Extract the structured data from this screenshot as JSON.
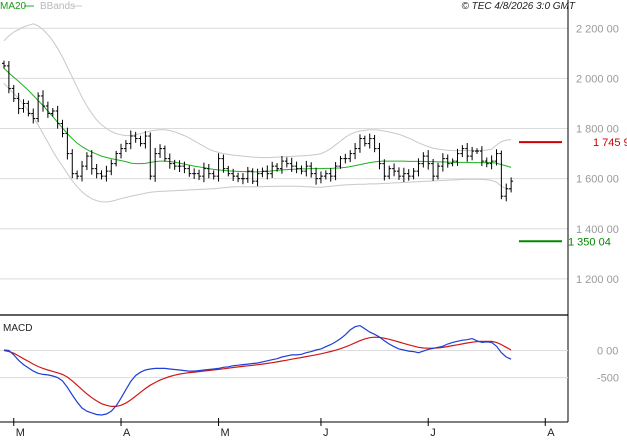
{
  "header": {
    "legend_ma": "MA20",
    "legend_bb": "BBands",
    "copyright": "© TEC 4/8/2026 3:0 GMT"
  },
  "colors": {
    "ma": "#1fb11f",
    "bbands": "#c8c8c8",
    "bars": "#000000",
    "macd_line": "#1f3fd6",
    "signal_line": "#d01818",
    "resistance": "#cc0000",
    "support": "#008800",
    "grid": "#dcdcdc"
  },
  "levels": {
    "resistance_label": "1 745 9",
    "support_label": "1 350 04"
  },
  "macd": {
    "title": "MACD"
  },
  "chart_data": [
    {
      "type": "ohlc",
      "title": "",
      "yticks": [
        "1 200 00",
        "1 400 00",
        "1 600 00",
        "1 800 00",
        "2 000 00",
        "2 200 00"
      ],
      "ytick_values": [
        1200,
        1400,
        1600,
        1800,
        2000,
        2200
      ],
      "ylim": [
        1060,
        2265
      ],
      "xlim": [
        0,
        115
      ],
      "x_ticks": [
        {
          "label": "M",
          "x": 2
        },
        {
          "label": "A",
          "x": 24
        },
        {
          "label": "M",
          "x": 44
        },
        {
          "label": "J",
          "x": 65
        },
        {
          "label": "J",
          "x": 87
        },
        {
          "label": "A",
          "x": 111
        }
      ],
      "x_tick_values": [
        2,
        24,
        44,
        65,
        87,
        111
      ],
      "grid": true,
      "legend": "top-left",
      "resistance": 1745.9,
      "support": 1350.04,
      "level_x_range": [
        112,
        121
      ],
      "closes": [
        2050,
        1960,
        1920,
        1880,
        1900,
        1860,
        1840,
        1930,
        1890,
        1860,
        1870,
        1820,
        1780,
        1700,
        1620,
        1610,
        1650,
        1690,
        1640,
        1620,
        1610,
        1630,
        1660,
        1700,
        1720,
        1740,
        1770,
        1760,
        1740,
        1770,
        1610,
        1700,
        1720,
        1680,
        1660,
        1650,
        1650,
        1640,
        1620,
        1620,
        1610,
        1640,
        1620,
        1610,
        1680,
        1640,
        1620,
        1610,
        1600,
        1600,
        1630,
        1590,
        1620,
        1630,
        1620,
        1650,
        1640,
        1670,
        1660,
        1650,
        1640,
        1630,
        1650,
        1620,
        1600,
        1610,
        1620,
        1610,
        1650,
        1680,
        1680,
        1700,
        1720,
        1760,
        1740,
        1760,
        1720,
        1660,
        1610,
        1640,
        1630,
        1610,
        1620,
        1610,
        1630,
        1660,
        1690,
        1660,
        1610,
        1650,
        1680,
        1660,
        1670,
        1700,
        1720,
        1690,
        1710,
        1710,
        1670,
        1660,
        1670,
        1700,
        1530,
        1560,
        1590
      ],
      "ma20": [
        2040,
        2022,
        2005,
        1988,
        1970,
        1952,
        1932,
        1912,
        1892,
        1870,
        1848,
        1825,
        1802,
        1780,
        1760,
        1742,
        1728,
        1716,
        1706,
        1698,
        1690,
        1685,
        1680,
        1676,
        1672,
        1668,
        1662,
        1660,
        1660,
        1661,
        1665,
        1668,
        1670,
        1670,
        1668,
        1666,
        1662,
        1658,
        1654,
        1650,
        1647,
        1644,
        1640,
        1637,
        1635,
        1633,
        1631,
        1630,
        1629,
        1628,
        1628,
        1627,
        1627,
        1628,
        1629,
        1631,
        1633,
        1635,
        1636,
        1637,
        1638,
        1639,
        1639,
        1640,
        1640,
        1640,
        1641,
        1641,
        1642,
        1643,
        1645,
        1648,
        1652,
        1656,
        1660,
        1664,
        1667,
        1669,
        1670,
        1670,
        1670,
        1670,
        1670,
        1669,
        1669,
        1669,
        1669,
        1668,
        1668,
        1667,
        1667,
        1666,
        1665,
        1665,
        1665,
        1665,
        1664,
        1664,
        1664,
        1664,
        1664,
        1662,
        1656,
        1651,
        1645
      ],
      "bb_upper": [
        2150,
        2170,
        2185,
        2195,
        2205,
        2212,
        2218,
        2210,
        2195,
        2175,
        2150,
        2120,
        2085,
        2045,
        2005,
        1965,
        1925,
        1890,
        1860,
        1835,
        1815,
        1800,
        1788,
        1780,
        1775,
        1772,
        1772,
        1775,
        1780,
        1785,
        1790,
        1793,
        1795,
        1795,
        1792,
        1787,
        1780,
        1772,
        1762,
        1751,
        1740,
        1729,
        1718,
        1710,
        1705,
        1700,
        1697,
        1694,
        1692,
        1690,
        1688,
        1686,
        1685,
        1684,
        1684,
        1685,
        1686,
        1687,
        1688,
        1689,
        1690,
        1691,
        1692,
        1694,
        1696,
        1700,
        1708,
        1720,
        1735,
        1750,
        1765,
        1777,
        1785,
        1790,
        1793,
        1795,
        1795,
        1793,
        1790,
        1786,
        1782,
        1777,
        1770,
        1762,
        1753,
        1743,
        1735,
        1728,
        1722,
        1718,
        1715,
        1713,
        1712,
        1712,
        1712,
        1712,
        1712,
        1712,
        1713,
        1714,
        1718,
        1734,
        1748,
        1754,
        1756
      ],
      "bb_lower": [
        1980,
        1960,
        1940,
        1920,
        1895,
        1870,
        1845,
        1815,
        1780,
        1745,
        1710,
        1678,
        1650,
        1620,
        1592,
        1568,
        1548,
        1532,
        1520,
        1512,
        1508,
        1507,
        1510,
        1515,
        1520,
        1525,
        1530,
        1534,
        1538,
        1542,
        1546,
        1548,
        1549,
        1550,
        1551,
        1552,
        1553,
        1554,
        1555,
        1556,
        1557,
        1558,
        1559,
        1560,
        1562,
        1564,
        1566,
        1567,
        1568,
        1568,
        1568,
        1568,
        1568,
        1568,
        1569,
        1569,
        1570,
        1570,
        1570,
        1570,
        1570,
        1569,
        1568,
        1567,
        1566,
        1566,
        1568,
        1570,
        1572,
        1574,
        1575,
        1576,
        1577,
        1578,
        1578,
        1579,
        1579,
        1580,
        1581,
        1582,
        1583,
        1584,
        1585,
        1586,
        1587,
        1588,
        1589,
        1590,
        1591,
        1592,
        1593,
        1594,
        1595,
        1596,
        1597,
        1598,
        1598,
        1598,
        1597,
        1596,
        1593,
        1586,
        1570,
        1560,
        1555
      ]
    },
    {
      "type": "line",
      "title": "MACD",
      "series": [
        {
          "name": "",
          "values": [
            10,
            0,
            -80,
            -180,
            -260,
            -320,
            -380,
            -420,
            -440,
            -450,
            -470,
            -500,
            -560,
            -680,
            -820,
            -950,
            -1060,
            -1120,
            -1150,
            -1180,
            -1190,
            -1170,
            -1120,
            -1020,
            -880,
            -720,
            -570,
            -460,
            -400,
            -360,
            -340,
            -330,
            -330,
            -330,
            -340,
            -350,
            -360,
            -370,
            -380,
            -380,
            -370,
            -360,
            -350,
            -340,
            -330,
            -310,
            -300,
            -280,
            -270,
            -260,
            -250,
            -240,
            -230,
            -210,
            -190,
            -170,
            -150,
            -120,
            -100,
            -80,
            -80,
            -70,
            -40,
            -20,
            10,
            30,
            70,
            110,
            160,
            220,
            290,
            380,
            440,
            460,
            400,
            340,
            300,
            250,
            180,
            120,
            70,
            30,
            10,
            -10,
            -20,
            -40,
            -10,
            20,
            40,
            60,
            80,
            120,
            150,
            170,
            190,
            200,
            220,
            180,
            150,
            160,
            150,
            80,
            -40,
            -120,
            -160
          ]
        },
        {
          "name": "",
          "values": [
            0,
            -20,
            -50,
            -100,
            -150,
            -200,
            -250,
            -295,
            -330,
            -360,
            -385,
            -410,
            -440,
            -490,
            -560,
            -640,
            -720,
            -800,
            -870,
            -930,
            -980,
            -1010,
            -1030,
            -1030,
            -1010,
            -970,
            -910,
            -840,
            -770,
            -700,
            -640,
            -590,
            -545,
            -510,
            -480,
            -455,
            -435,
            -420,
            -408,
            -398,
            -388,
            -378,
            -368,
            -358,
            -348,
            -338,
            -326,
            -314,
            -302,
            -292,
            -282,
            -272,
            -262,
            -250,
            -238,
            -224,
            -210,
            -194,
            -178,
            -160,
            -144,
            -128,
            -112,
            -96,
            -78,
            -60,
            -40,
            -18,
            6,
            34,
            66,
            102,
            142,
            182,
            214,
            236,
            246,
            242,
            228,
            208,
            184,
            158,
            132,
            106,
            82,
            60,
            46,
            42,
            42,
            48,
            58,
            74,
            90,
            106,
            122,
            138,
            154,
            164,
            168,
            170,
            168,
            150,
            110,
            60,
            10
          ]
        }
      ],
      "yticks": [
        "0 00",
        "-500"
      ],
      "ytick_values": [
        0,
        -500
      ],
      "ylim": [
        -1300,
        600
      ],
      "grid": true
    }
  ]
}
